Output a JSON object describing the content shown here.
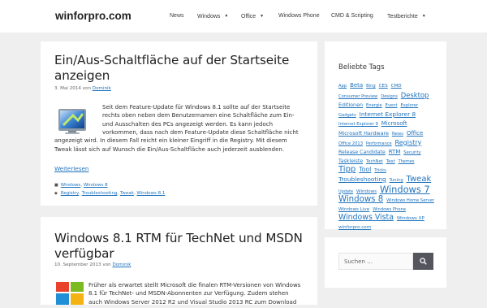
{
  "site": {
    "logo": "winforpro.com"
  },
  "nav": [
    {
      "label": "News",
      "dropdown": false
    },
    {
      "label": "Windows",
      "dropdown": true
    },
    {
      "label": "Office",
      "dropdown": true
    },
    {
      "label": "Windows Phone",
      "dropdown": false
    },
    {
      "label": "CMD & Scripting",
      "dropdown": false
    },
    {
      "label": "Testberichte",
      "dropdown": true
    }
  ],
  "posts": [
    {
      "title_line1": "Ein/Aus-Schaltfläche auf der Startseite",
      "title_line2": "anzeigen",
      "date": "3. Mai 2014",
      "by": "von",
      "author": "Dominik",
      "excerpt_lines": [
        "Seit dem Feature-Update für Windows 8.1 sollte auf der Startseite",
        "rechts oben neben dem Benutzernamen eine Schaltfläche zum Ein-",
        "und Ausschalten des PCs angezeigt werden. Es kann jedoch",
        "vorkommen, dass nach dem Feature-Update diese Schaltfläche nicht",
        "angezeigt wird. In diesem Fall reicht ein kleiner Eingriff in die Registry. Mit diesem",
        "Tweak lässt sich auf Wunsch die Ein/Aus-Schaltfläche auch jederzeit ausblenden."
      ],
      "read_more": "Weiterlesen",
      "categories": [
        "Windows",
        "Windows 8"
      ],
      "tags": [
        "Registry",
        "Troubleshooting",
        "Tweak",
        "Windows 8.1"
      ]
    },
    {
      "title_line1": "Windows 8.1 RTM für TechNet und MSDN",
      "title_line2": "verfügbar",
      "date": "10. September 2013",
      "by": "von",
      "author": "Dominik",
      "excerpt_lines": [
        "Früher als erwartet stellt Microsoft die finalen RTM-Versionen von Windows",
        "8.1 für TechNet- und MSDN-Abonnenten zur Verfügung. Zudem stehen",
        "auch Windows Server 2012 R2 und Visual Studio 2013 RC zum Download"
      ]
    }
  ],
  "sidebar": {
    "tags_title": "Beliebte Tags",
    "tags": [
      {
        "t": "App",
        "s": 5.2
      },
      {
        "t": "Beta",
        "s": 7.0
      },
      {
        "t": "Bing",
        "s": 5.2
      },
      {
        "t": "CES",
        "s": 5.6
      },
      {
        "t": "CMD",
        "s": 5.6
      },
      {
        "t": "Consumer Preview",
        "s": 5.2
      },
      {
        "t": "Designs",
        "s": 5.2
      },
      {
        "t": "Desktop",
        "s": 8.4
      },
      {
        "t": "Editionen",
        "s": 6.4
      },
      {
        "t": "Energie",
        "s": 5.2
      },
      {
        "t": "Event",
        "s": 5.2
      },
      {
        "t": "Explorer",
        "s": 5.2
      },
      {
        "t": "Gadgets",
        "s": 5.2
      },
      {
        "t": "Internet Explorer 8",
        "s": 7.4
      },
      {
        "t": "Internet Explorer 9",
        "s": 5.2
      },
      {
        "t": "Microsoft",
        "s": 7.0
      },
      {
        "t": "Microsoft Hardware",
        "s": 6.4
      },
      {
        "t": "News",
        "s": 5.2
      },
      {
        "t": "Office",
        "s": 7.0
      },
      {
        "t": "Office 2013",
        "s": 5.2
      },
      {
        "t": "Performance",
        "s": 5.0
      },
      {
        "t": "Registry",
        "s": 8.0
      },
      {
        "t": "Release Candidate",
        "s": 6.2
      },
      {
        "t": "RTM",
        "s": 7.0
      },
      {
        "t": "Security",
        "s": 5.2
      },
      {
        "t": "Taskleiste",
        "s": 6.2
      },
      {
        "t": "TechNet",
        "s": 5.2
      },
      {
        "t": "Test",
        "s": 5.6
      },
      {
        "t": "Themes",
        "s": 5.0
      },
      {
        "t": "Tipp",
        "s": 10.0
      },
      {
        "t": "Tool",
        "s": 7.8
      },
      {
        "t": "Tricks",
        "s": 5.2
      },
      {
        "t": "Troubleshooting",
        "s": 7.4
      },
      {
        "t": "Tuning",
        "s": 5.2
      },
      {
        "t": "Tweak",
        "s": 10.0
      },
      {
        "t": "Update",
        "s": 5.0
      },
      {
        "t": "Windows",
        "s": 5.6
      },
      {
        "t": "Windows 7",
        "s": 11.4
      },
      {
        "t": "Windows 8",
        "s": 10.2
      },
      {
        "t": "Windows Home Server",
        "s": 5.2
      },
      {
        "t": "Windows Live",
        "s": 5.6
      },
      {
        "t": "Windows Phone",
        "s": 5.2
      },
      {
        "t": "Windows Vista",
        "s": 9.4
      },
      {
        "t": "Windows XP",
        "s": 5.6
      },
      {
        "t": "winforpro.com",
        "s": 5.6
      }
    ],
    "search_placeholder": "Suchen …"
  },
  "colors": {
    "link": "#1e73be",
    "background": "#efefef",
    "search_button": "#55555e"
  }
}
